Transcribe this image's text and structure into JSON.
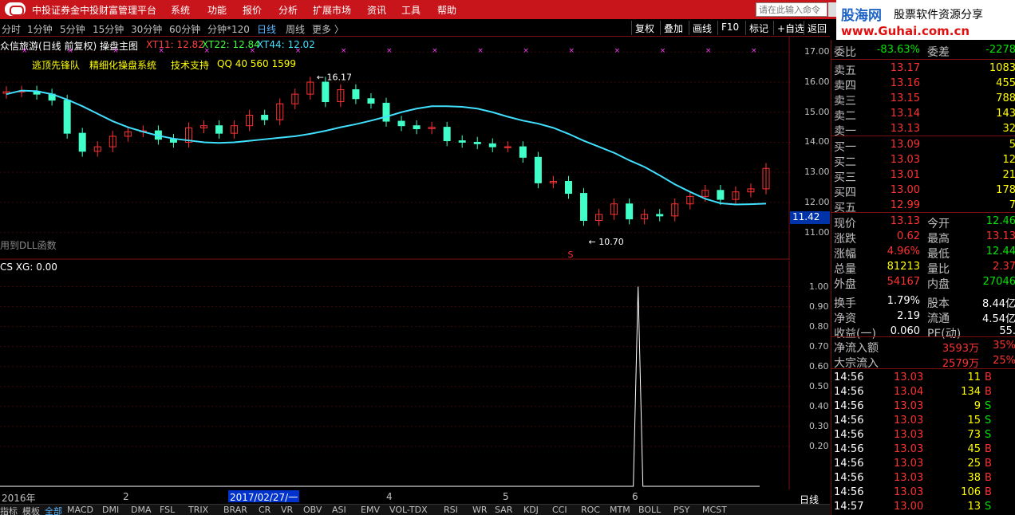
{
  "window": {
    "title": "中投证券金中投财富管理平台",
    "menu": [
      "系统",
      "功能",
      "报价",
      "分析",
      "扩展市场",
      "资讯",
      "工具",
      "帮助"
    ],
    "command_placeholder": "请在此输入命令"
  },
  "watermark": {
    "brand": "股海网",
    "slogan": "股票软件资源分享",
    "url": "www.Guhai.com.cn"
  },
  "periods": [
    "分时",
    "1分钟",
    "5分钟",
    "15分钟",
    "30分钟",
    "60分钟",
    "分钟*120",
    "日线",
    "周线",
    "更多 〉"
  ],
  "active_period": "日线",
  "toolbar": [
    "复权",
    "叠加",
    "画线",
    "F10",
    "标记",
    "+自选",
    "返回"
  ],
  "chart": {
    "title": "众信旅游(日线 前复权) 操盘主图",
    "xt11": "XT11: 12.82",
    "xt22": "XT22: 12.84",
    "xt44": "XT44: 12.02",
    "promo": [
      "逃顶先锋队",
      "精细化操盘系统",
      "技术支持",
      "QQ 40 560 1599"
    ],
    "high_label": "16.17",
    "low_label": "10.70",
    "dll_note": "用到DLL函数",
    "signal_mark": "S",
    "sub_title": "CS XG: 0.00",
    "cur_price": "11.42",
    "period_badge": "日线",
    "zoom": "+ - □"
  },
  "colors": {
    "up": "#ff3232",
    "down": "#40ffc8",
    "ma": "#40e0ff",
    "title_bar": "#c8141b"
  },
  "chart_data": {
    "type": "candlestick",
    "price_axis": [
      "17.00",
      "16.00",
      "15.00",
      "14.00",
      "13.00",
      "12.00",
      "11.00"
    ],
    "ylim": [
      10.3,
      17.3
    ],
    "sub_axis": [
      "1.00",
      "0.90",
      "0.80",
      "0.70",
      "0.60",
      "0.50",
      "0.40",
      "0.30",
      "0.20"
    ],
    "sub_ylim": [
      0,
      1.05
    ],
    "dates": [
      "2016年",
      "2",
      "2017/02/27/一",
      "4",
      "5",
      "6"
    ],
    "ma_line": [
      15.6,
      15.72,
      15.7,
      15.6,
      15.42,
      15.2,
      14.95,
      14.7,
      14.5,
      14.35,
      14.22,
      14.12,
      14.06,
      14.0,
      13.98,
      14.0,
      14.05,
      14.1,
      14.15,
      14.2,
      14.28,
      14.38,
      14.5,
      14.6,
      14.72,
      14.85,
      15.0,
      15.12,
      15.2,
      15.2,
      15.18,
      15.12,
      15.0,
      14.85,
      14.72,
      14.62,
      14.48,
      14.28,
      14.05,
      13.85,
      13.65,
      13.4,
      13.18,
      12.9,
      12.6,
      12.35,
      12.12,
      11.97,
      11.93,
      11.94,
      11.96
    ],
    "close": [
      15.68,
      15.7,
      15.6,
      15.4,
      14.3,
      13.7,
      13.85,
      14.2,
      14.35,
      14.38,
      14.1,
      14.0,
      14.48,
      14.55,
      14.3,
      14.55,
      14.9,
      14.75,
      15.28,
      15.6,
      16.0,
      15.35,
      15.75,
      15.45,
      15.3,
      14.7,
      14.55,
      14.45,
      14.5,
      14.05,
      14.0,
      13.95,
      13.85,
      13.85,
      13.5,
      12.65,
      12.7,
      12.3,
      11.4,
      11.6,
      11.95,
      11.45,
      11.6,
      11.55,
      11.95,
      12.2,
      12.4,
      12.1,
      12.35,
      12.45,
      13.13
    ],
    "signal": [
      0,
      0,
      0,
      0,
      0,
      0,
      0,
      0,
      0,
      0,
      0,
      0,
      0,
      0,
      0,
      0,
      0,
      0,
      0,
      0,
      0,
      0,
      0,
      0,
      0,
      0,
      0,
      0,
      0,
      0,
      0,
      0,
      0,
      0,
      0,
      0,
      0,
      0,
      0,
      0,
      0,
      0,
      1,
      0,
      0,
      0,
      0,
      0,
      0,
      0,
      0
    ]
  },
  "quote": {
    "webi_label": "委比",
    "webi_value": "-83.63%",
    "wecha_label": "委差",
    "wecha_value": "-2278",
    "asks": [
      {
        "label": "卖五",
        "price": "13.17",
        "vol": "1083"
      },
      {
        "label": "卖四",
        "price": "13.16",
        "vol": "455"
      },
      {
        "label": "卖三",
        "price": "13.15",
        "vol": "788"
      },
      {
        "label": "卖二",
        "price": "13.14",
        "vol": "143"
      },
      {
        "label": "卖一",
        "price": "13.13",
        "vol": "32"
      }
    ],
    "bids": [
      {
        "label": "买一",
        "price": "13.09",
        "vol": "5"
      },
      {
        "label": "买二",
        "price": "13.03",
        "vol": "12"
      },
      {
        "label": "买三",
        "price": "13.01",
        "vol": "21"
      },
      {
        "label": "买四",
        "price": "13.00",
        "vol": "178"
      },
      {
        "label": "买五",
        "price": "12.99",
        "vol": "7"
      }
    ],
    "stats": [
      {
        "l1": "现价",
        "v1": "13.13",
        "c1": "red",
        "l2": "今开",
        "v2": "12.46",
        "c2": "green"
      },
      {
        "l1": "涨跌",
        "v1": "0.62",
        "c1": "red",
        "l2": "最高",
        "v2": "13.13",
        "c2": "red"
      },
      {
        "l1": "涨幅",
        "v1": "4.96%",
        "c1": "red",
        "l2": "最低",
        "v2": "12.44",
        "c2": "green"
      },
      {
        "l1": "总量",
        "v1": "81213",
        "c1": "yellow",
        "l2": "量比",
        "v2": "2.37",
        "c2": "red"
      },
      {
        "l1": "外盘",
        "v1": "54167",
        "c1": "red",
        "l2": "内盘",
        "v2": "27046",
        "c2": "green"
      },
      {
        "l1": "换手",
        "v1": "1.79%",
        "c1": "white",
        "l2": "股本",
        "v2": "8.44亿",
        "c2": "white"
      },
      {
        "l1": "净资",
        "v1": "2.19",
        "c1": "white",
        "l2": "流通",
        "v2": "4.54亿",
        "c2": "white"
      },
      {
        "l1": "收益(一)",
        "v1": "0.060",
        "c1": "white",
        "l2": "PE(动)",
        "v2": "55.",
        "c2": "white"
      }
    ],
    "flows": [
      {
        "label": "净流入额",
        "value": "3593万",
        "pct": "35%"
      },
      {
        "label": "大宗流入",
        "value": "2579万",
        "pct": "25%"
      }
    ],
    "ticks": [
      {
        "time": "14:56",
        "price": "13.03",
        "pc": "red",
        "vol": "11",
        "bs": "B",
        "bc": "red"
      },
      {
        "time": "14:56",
        "price": "13.04",
        "pc": "red",
        "vol": "134",
        "bs": "B",
        "bc": "red"
      },
      {
        "time": "14:56",
        "price": "13.03",
        "pc": "red",
        "vol": "9",
        "bs": "S",
        "bc": "green"
      },
      {
        "time": "14:56",
        "price": "13.03",
        "pc": "red",
        "vol": "15",
        "bs": "S",
        "bc": "green"
      },
      {
        "time": "14:56",
        "price": "13.03",
        "pc": "red",
        "vol": "73",
        "bs": "S",
        "bc": "green"
      },
      {
        "time": "14:56",
        "price": "13.03",
        "pc": "red",
        "vol": "45",
        "bs": "B",
        "bc": "red"
      },
      {
        "time": "14:56",
        "price": "13.03",
        "pc": "red",
        "vol": "25",
        "bs": "B",
        "bc": "red"
      },
      {
        "time": "14:56",
        "price": "13.03",
        "pc": "red",
        "vol": "38",
        "bs": "B",
        "bc": "red"
      },
      {
        "time": "14:56",
        "price": "13.03",
        "pc": "red",
        "vol": "106",
        "bs": "B",
        "bc": "red"
      },
      {
        "time": "14:57",
        "price": "13.00",
        "pc": "red",
        "vol": "13",
        "bs": "S",
        "bc": "green"
      }
    ]
  },
  "indicator_tabs": [
    "指标",
    "模板",
    "全部",
    "MACD",
    "DMI",
    "DMA",
    "FSL",
    "TRIX",
    "BRAR",
    "CR",
    "VR",
    "OBV",
    "ASI",
    "EMV",
    "VOL-TDX",
    "RSI",
    "WR",
    "SAR",
    "KDJ",
    "CCI",
    "ROC",
    "MTM",
    "BOLL",
    "PSY",
    "MCST"
  ],
  "active_tab": "全部"
}
